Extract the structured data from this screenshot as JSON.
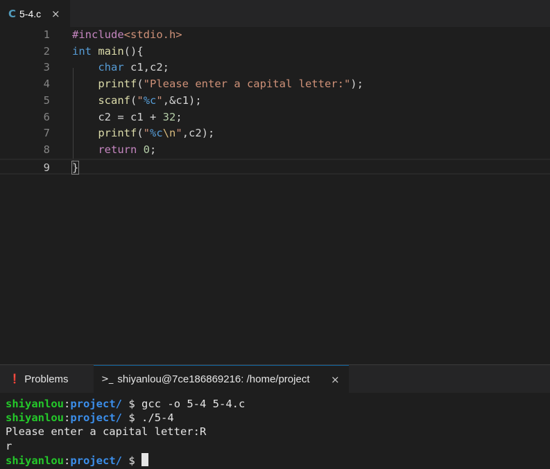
{
  "tab": {
    "icon": "C",
    "label": "5-4.c",
    "close": "×"
  },
  "editor": {
    "lines": [
      {
        "num": "1",
        "text": "#include<stdio.h>"
      },
      {
        "num": "2",
        "text": "int main(){"
      },
      {
        "num": "3",
        "text": "    char c1,c2;"
      },
      {
        "num": "4",
        "text": "    printf(\"Please enter a capital letter:\");"
      },
      {
        "num": "5",
        "text": "    scanf(\"%c\",&c1);"
      },
      {
        "num": "6",
        "text": "    c2 = c1 + 32;"
      },
      {
        "num": "7",
        "text": "    printf(\"%c\\n\",c2);"
      },
      {
        "num": "8",
        "text": "    return 0;"
      },
      {
        "num": "9",
        "text": "}"
      }
    ],
    "active_line": "9"
  },
  "panel": {
    "problems_label": "Problems",
    "problems_icon": "❗",
    "terminal_icon": ">_",
    "terminal_label": "shiyanlou@7ce186869216: /home/project",
    "close": "×"
  },
  "terminal": {
    "user": "shiyanlou",
    "path": "project/",
    "prompt": "$",
    "lines": [
      {
        "type": "cmd",
        "cmd": "gcc -o 5-4 5-4.c"
      },
      {
        "type": "cmd",
        "cmd": "./5-4"
      },
      {
        "type": "out",
        "text": "Please enter a capital letter:R"
      },
      {
        "type": "out",
        "text": "r"
      },
      {
        "type": "cmd",
        "cmd": ""
      }
    ]
  },
  "colors": {
    "background": "#1e1e1e",
    "prompt_user": "#24c92a",
    "prompt_path": "#3b8eea",
    "keyword": "#569cd6",
    "string": "#ce9178"
  }
}
